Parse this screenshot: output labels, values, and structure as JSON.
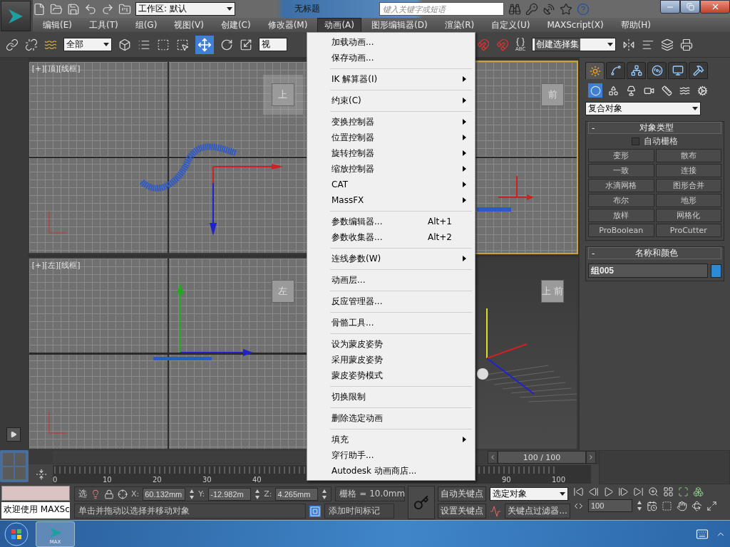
{
  "title_bar": {
    "workspace": "工作区: 默认",
    "title": "无标题",
    "search": {
      "placeholder": "键入关键字或短语"
    }
  },
  "menu_bar": [
    {
      "label": "编辑(E)",
      "selected": false
    },
    {
      "label": "工具(T)",
      "selected": false
    },
    {
      "label": "组(G)",
      "selected": false
    },
    {
      "label": "视图(V)",
      "selected": false
    },
    {
      "label": "创建(C)",
      "selected": false
    },
    {
      "label": "修改器(M)",
      "selected": false
    },
    {
      "label": "动画(A)",
      "selected": true
    },
    {
      "label": "图形编辑器(D)",
      "selected": false
    },
    {
      "label": "渲染(R)",
      "selected": false
    },
    {
      "label": "自定义(U)",
      "selected": false
    },
    {
      "label": "MAXScript(X)",
      "selected": false
    },
    {
      "label": "帮助(H)",
      "selected": false
    }
  ],
  "toolbar": {
    "selection_filter": "全部",
    "reference_coord": "视",
    "selection_set": "创建选择集",
    "abc": "ABC"
  },
  "viewports": [
    {
      "kind": "top",
      "label": "[+][顶][线框]",
      "active": false,
      "cube": "上"
    },
    {
      "kind": "front",
      "active": true,
      "cube": "前"
    },
    {
      "kind": "left",
      "label": "[+][左][线框]",
      "active": false,
      "cube": "左"
    },
    {
      "kind": "perspective",
      "active": false,
      "cube": "上 前"
    }
  ],
  "animation_menu": [
    [
      {
        "label": "加载动画...",
        "submenu": false
      },
      {
        "label": "保存动画...",
        "submenu": false
      }
    ],
    [
      {
        "label": "IK 解算器(I)",
        "submenu": true
      }
    ],
    [
      {
        "label": "约束(C)",
        "submenu": true
      }
    ],
    [
      {
        "label": "变换控制器",
        "submenu": true
      },
      {
        "label": "位置控制器",
        "submenu": true
      },
      {
        "label": "旋转控制器",
        "submenu": true
      },
      {
        "label": "缩放控制器",
        "submenu": true
      },
      {
        "label": "CAT",
        "submenu": true
      },
      {
        "label": "MassFX",
        "submenu": true
      }
    ],
    [
      {
        "label": "参数编辑器...",
        "shortcut": "Alt+1",
        "submenu": false
      },
      {
        "label": "参数收集器...",
        "shortcut": "Alt+2",
        "submenu": false
      }
    ],
    [
      {
        "label": "连线参数(W)",
        "submenu": true
      }
    ],
    [
      {
        "label": "动画层...",
        "submenu": false
      }
    ],
    [
      {
        "label": "反应管理器...",
        "submenu": false
      }
    ],
    [
      {
        "label": "骨骼工具...",
        "submenu": false
      }
    ],
    [
      {
        "label": "设为蒙皮姿势",
        "submenu": false
      },
      {
        "label": "采用蒙皮姿势",
        "submenu": false
      },
      {
        "label": "蒙皮姿势模式",
        "submenu": false
      }
    ],
    [
      {
        "label": "切换限制",
        "submenu": false
      }
    ],
    [
      {
        "label": "删除选定动画",
        "submenu": false
      }
    ],
    [
      {
        "label": "填充",
        "submenu": true
      },
      {
        "label": "穿行助手...",
        "submenu": false
      },
      {
        "label": "Autodesk 动画商店...",
        "submenu": false
      }
    ]
  ],
  "command_panel": {
    "tabs": [
      {
        "selected": true
      },
      {
        "selected": false
      },
      {
        "selected": false
      },
      {
        "selected": false
      },
      {
        "selected": false
      },
      {
        "selected": false
      }
    ],
    "categories": [
      {
        "selected": true
      },
      {
        "selected": false
      },
      {
        "selected": false
      },
      {
        "selected": false
      },
      {
        "selected": false
      },
      {
        "selected": false
      },
      {
        "selected": false
      }
    ],
    "dropdown": "复合对象",
    "object_type": {
      "collapse": "-",
      "title": "对象类型",
      "autogrid": {
        "label": "自动栅格",
        "checked": false
      },
      "buttons": [
        "变形",
        "散布",
        "一致",
        "连接",
        "水滴网格",
        "图形合并",
        "布尔",
        "地形",
        "放样",
        "网格化",
        "ProBoolean",
        "ProCutter"
      ]
    },
    "name_color": {
      "collapse": "-",
      "title": "名称和颜色",
      "name": "组005",
      "color": "#2f8ad6"
    }
  },
  "timeline": {
    "slider": {
      "label": "100 / 100",
      "level": 1
    },
    "ticks": [
      "0",
      "10",
      "20",
      "30",
      "40",
      "90",
      "100"
    ]
  },
  "status": {
    "listener": "欢迎使用 MAXSc",
    "selection": "选",
    "x_label": "X:",
    "x": "60.132mm",
    "y_label": "Y:",
    "y": "-12.982m",
    "z_label": "Z:",
    "z": "4.265mm",
    "grid": "栅格 = 10.0mm",
    "prompt": "单击并拖动以选择并移动对象",
    "time_tag": "添加时间标记",
    "auto_key": "自动关键点",
    "set_key": "设置关键点",
    "key_mode": "选定对象",
    "key_filters": "关键点过滤器...",
    "frame": "100"
  },
  "taskbar": {
    "app": "MAX"
  }
}
